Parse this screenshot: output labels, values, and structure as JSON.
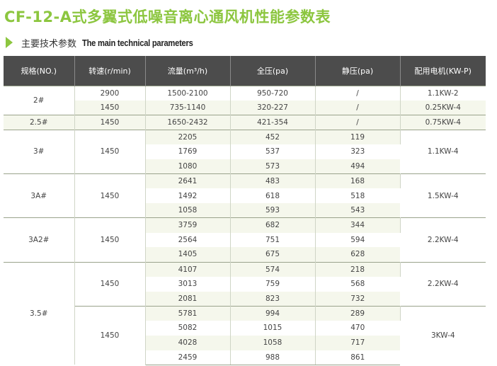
{
  "title": "CF-12-A式多翼式低噪音离心通风机性能参数表",
  "subheading": {
    "cn": "主要技术参数",
    "en": "The main technical parameters"
  },
  "table": {
    "headers": [
      "规格(NO.)",
      "转速(r/min)",
      "流量(m³/h)",
      "全压(pa)",
      "静压(pa)",
      "配用电机(KW-P)"
    ],
    "rows": [
      [
        "2#",
        "2900",
        "1500-2100",
        "950-720",
        "/",
        "1.1KW-2"
      ],
      [
        "",
        "1450",
        "735-1140",
        "320-227",
        "/",
        "0.25KW-4"
      ],
      [
        "2.5#",
        "1450",
        "1650-2432",
        "421-354",
        "/",
        "0.75KW-4"
      ],
      [
        "3#",
        "1450",
        "2205",
        "452",
        "119",
        "1.1KW-4"
      ],
      [
        "",
        "",
        "1769",
        "537",
        "323",
        ""
      ],
      [
        "",
        "",
        "1080",
        "573",
        "494",
        ""
      ],
      [
        "3A#",
        "1450",
        "2641",
        "483",
        "168",
        "1.5KW-4"
      ],
      [
        "",
        "",
        "1492",
        "618",
        "518",
        ""
      ],
      [
        "",
        "",
        "1058",
        "593",
        "543",
        ""
      ],
      [
        "3A2#",
        "1450",
        "3759",
        "682",
        "344",
        "2.2KW-4"
      ],
      [
        "",
        "",
        "2564",
        "751",
        "594",
        ""
      ],
      [
        "",
        "",
        "1405",
        "675",
        "628",
        ""
      ],
      [
        "3.5#",
        "1450",
        "4107",
        "574",
        "218",
        "2.2KW-4"
      ],
      [
        "",
        "",
        "3013",
        "759",
        "568",
        ""
      ],
      [
        "",
        "",
        "2081",
        "823",
        "732",
        ""
      ],
      [
        "",
        "1450",
        "5781",
        "994",
        "289",
        "3KW-4"
      ],
      [
        "",
        "",
        "5082",
        "1015",
        "470",
        ""
      ],
      [
        "",
        "",
        "4028",
        "1058",
        "717",
        ""
      ],
      [
        "",
        "",
        "2459",
        "988",
        "861",
        ""
      ]
    ]
  }
}
